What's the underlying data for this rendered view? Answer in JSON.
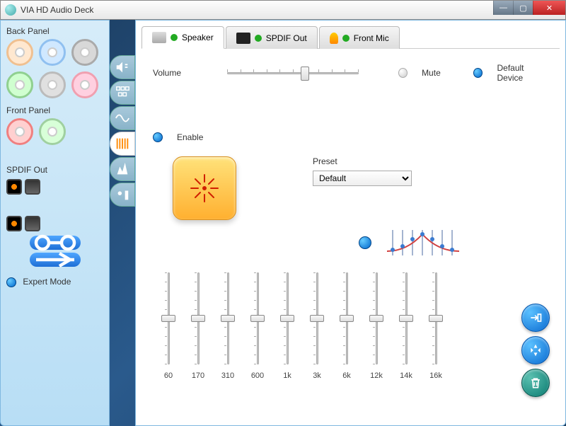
{
  "window": {
    "title": "VIA HD Audio Deck"
  },
  "sidebar": {
    "back_panel_label": "Back Panel",
    "front_panel_label": "Front Panel",
    "spdif_label": "SPDIF Out",
    "expert_mode_label": "Expert Mode"
  },
  "tabs": [
    {
      "label": "Speaker",
      "icon": "speaker"
    },
    {
      "label": "SPDIF Out",
      "icon": "spdif"
    },
    {
      "label": "Front Mic",
      "icon": "mic"
    }
  ],
  "speaker": {
    "volume_label": "Volume",
    "volume_value": 55,
    "mute_label": "Mute",
    "mute": false,
    "default_device_label": "Default Device",
    "default_device": true
  },
  "equalizer": {
    "enable_label": "Enable",
    "enabled": true,
    "preset_label": "Preset",
    "preset_selected": "Default",
    "bands": [
      {
        "freq": "60",
        "gain": 0
      },
      {
        "freq": "170",
        "gain": 0
      },
      {
        "freq": "310",
        "gain": 0
      },
      {
        "freq": "600",
        "gain": 0
      },
      {
        "freq": "1k",
        "gain": 0
      },
      {
        "freq": "3k",
        "gain": 0
      },
      {
        "freq": "6k",
        "gain": 0
      },
      {
        "freq": "12k",
        "gain": 0
      },
      {
        "freq": "14k",
        "gain": 0
      },
      {
        "freq": "16k",
        "gain": 0
      }
    ]
  },
  "actions": {
    "save": "save-icon",
    "reset": "reset-icon",
    "delete": "trash-icon"
  }
}
